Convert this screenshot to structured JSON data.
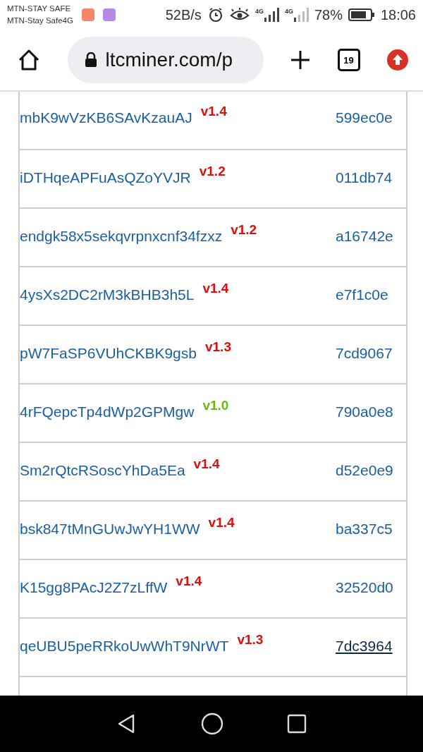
{
  "status_bar": {
    "carrier_1": "MTN-STAY SAFE",
    "carrier_2": "MTN-Stay Safe4G",
    "net_speed": "52B/s",
    "signal_1_label": "4G",
    "signal_2_label": "4G",
    "battery": "78%",
    "time": "18:06"
  },
  "browser": {
    "url": "ltcminer.com/p",
    "tab_count": "19"
  },
  "rows": [
    {
      "address": "mbK9wVzKB6SAvKzauAJ",
      "version": "v1.4",
      "color": "#e00d0d",
      "hash": "599ec0e",
      "focused": false
    },
    {
      "address": "iDTHqeAPFuAsQZoYVJR",
      "version": "v1.2",
      "color": "#e00d0d",
      "hash": "011db74",
      "focused": false
    },
    {
      "address": "endgk58x5sekqvrpnxcnf34fzxz",
      "version": "v1.2",
      "color": "#e00d0d",
      "hash": "a16742e",
      "focused": false
    },
    {
      "address": "4ysXs2DC2rM3kBHB3h5L",
      "version": "v1.4",
      "color": "#e00d0d",
      "hash": "e7f1c0e",
      "focused": false
    },
    {
      "address": "pW7FaSP6VUhCKBK9gsb",
      "version": "v1.3",
      "color": "#e00d0d",
      "hash": "7cd9067",
      "focused": false
    },
    {
      "address": "4rFQepcTp4dWp2GPMgw",
      "version": "v1.0",
      "color": "#66bb11",
      "hash": "790a0e8",
      "focused": false
    },
    {
      "address": "Sm2rQtcRSoscYhDa5Ea",
      "version": "v1.4",
      "color": "#e00d0d",
      "hash": "d52e0e9",
      "focused": false
    },
    {
      "address": "bsk847tMnGUwJwYH1WW",
      "version": "v1.4",
      "color": "#e00d0d",
      "hash": "ba337c5",
      "focused": false
    },
    {
      "address": "K15gg8PAcJ2Z7zLffW",
      "version": "v1.4",
      "color": "#e00d0d",
      "hash": "32520d0",
      "focused": false
    },
    {
      "address": "qeUBU5peRRkoUwWhT9NrWT",
      "version": "v1.3",
      "color": "#e00d0d",
      "hash": "7dc3964",
      "focused": true
    }
  ]
}
